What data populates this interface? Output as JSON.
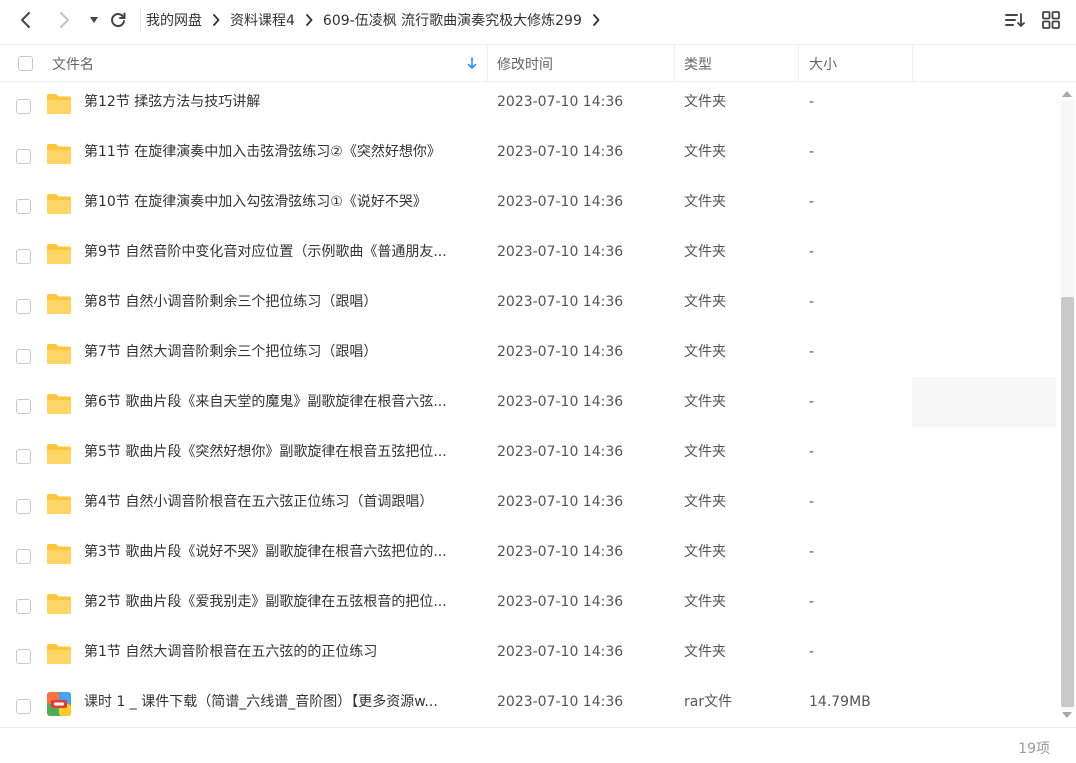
{
  "toolbar": {
    "back_icon": "chevron-left-icon",
    "forward_icon": "chevron-right-icon",
    "history_icon": "caret-down-icon",
    "refresh_icon": "refresh-icon",
    "sort_icon": "sort-icon",
    "view_icon": "grid-view-icon"
  },
  "breadcrumb": [
    "我的网盘",
    "资料课程4",
    "609-伍凌枫 流行歌曲演奏究极大修炼299"
  ],
  "columns": {
    "name": "文件名",
    "modified": "修改时间",
    "type": "类型",
    "size": "大小"
  },
  "files": [
    {
      "name": "第12节 揉弦方法与技巧讲解",
      "modified": "2023-07-10 14:36",
      "type": "文件夹",
      "size": "-",
      "icon": "folder-icon"
    },
    {
      "name": "第11节 在旋律演奏中加入击弦滑弦练习②《突然好想你》",
      "modified": "2023-07-10 14:36",
      "type": "文件夹",
      "size": "-",
      "icon": "folder-icon"
    },
    {
      "name": "第10节 在旋律演奏中加入勾弦滑弦练习①《说好不哭》",
      "modified": "2023-07-10 14:36",
      "type": "文件夹",
      "size": "-",
      "icon": "folder-icon"
    },
    {
      "name": "第9节 自然音阶中变化音对应位置（示例歌曲《普通朋友...",
      "modified": "2023-07-10 14:36",
      "type": "文件夹",
      "size": "-",
      "icon": "folder-icon"
    },
    {
      "name": "第8节 自然小调音阶剩余三个把位练习（跟唱）",
      "modified": "2023-07-10 14:36",
      "type": "文件夹",
      "size": "-",
      "icon": "folder-icon"
    },
    {
      "name": "第7节 自然大调音阶剩余三个把位练习（跟唱）",
      "modified": "2023-07-10 14:36",
      "type": "文件夹",
      "size": "-",
      "icon": "folder-icon"
    },
    {
      "name": "第6节 歌曲片段《来自天堂的魔鬼》副歌旋律在根音六弦...",
      "modified": "2023-07-10 14:36",
      "type": "文件夹",
      "size": "-",
      "icon": "folder-icon"
    },
    {
      "name": "第5节 歌曲片段《突然好想你》副歌旋律在根音五弦把位...",
      "modified": "2023-07-10 14:36",
      "type": "文件夹",
      "size": "-",
      "icon": "folder-icon"
    },
    {
      "name": "第4节 自然小调音阶根音在五六弦正位练习（首调跟唱）",
      "modified": "2023-07-10 14:36",
      "type": "文件夹",
      "size": "-",
      "icon": "folder-icon"
    },
    {
      "name": "第3节 歌曲片段《说好不哭》副歌旋律在根音六弦把位的...",
      "modified": "2023-07-10 14:36",
      "type": "文件夹",
      "size": "-",
      "icon": "folder-icon"
    },
    {
      "name": "第2节 歌曲片段《爱我别走》副歌旋律在五弦根音的把位...",
      "modified": "2023-07-10 14:36",
      "type": "文件夹",
      "size": "-",
      "icon": "folder-icon"
    },
    {
      "name": "第1节 自然大调音阶根音在五六弦的的正位练习",
      "modified": "2023-07-10 14:36",
      "type": "文件夹",
      "size": "-",
      "icon": "folder-icon"
    },
    {
      "name": "课时 1 _ 课件下载（简谱_六线谱_音阶图）【更多资源w...",
      "modified": "2023-07-10 14:36",
      "type": "rar文件",
      "size": "14.79MB",
      "icon": "archive-icon"
    }
  ],
  "footer": {
    "item_count": "19项"
  },
  "colors": {
    "folder": "#ffc53d",
    "sort_arrow": "#2b8cff",
    "scroll_thumb": "#c9c9c9"
  }
}
